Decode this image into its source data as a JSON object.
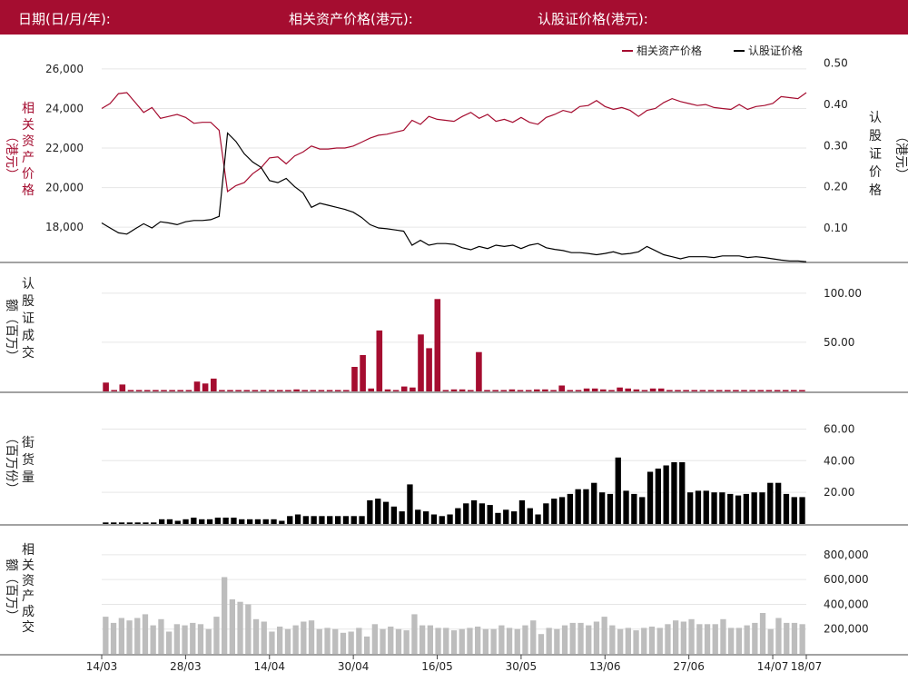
{
  "header": {
    "date_label": "日期(日/月/年):",
    "asset_price_label": "相关资产价格(港元):",
    "warrant_price_label": "认股证价格(港元):"
  },
  "colors": {
    "header": "#a50d30",
    "asset": "#a50d30",
    "warrant": "#000000",
    "turnover_asset": "#bdbdbd"
  },
  "chart_data": [
    {
      "type": "line",
      "panel": "price",
      "legend": [
        "相关资产价格",
        "认股证价格"
      ],
      "legend_position": "top-right",
      "ylabel_left": "相关资产价格（港元）",
      "ylabel_right": "认股证价格（港元）",
      "ylim_left": [
        16400,
        26500
      ],
      "ylim_right": [
        0.025,
        0.51
      ],
      "yticks_left": [
        "18,000",
        "20,000",
        "22,000",
        "24,000",
        "26,000"
      ],
      "yticks_left_values": [
        18000,
        20000,
        22000,
        24000,
        26000
      ],
      "yticks_right": [
        "0.10",
        "0.20",
        "0.30",
        "0.40",
        "0.50"
      ],
      "yticks_right_values": [
        0.1,
        0.2,
        0.3,
        0.4,
        0.5
      ],
      "series": [
        {
          "name": "相关资产价格",
          "axis": "left",
          "values": [
            24000,
            24250,
            24750,
            24800,
            24300,
            23800,
            24050,
            23500,
            23600,
            23700,
            23550,
            23250,
            23300,
            23300,
            22900,
            19800,
            20100,
            20250,
            20700,
            21000,
            21500,
            21550,
            21200,
            21600,
            21800,
            22100,
            21950,
            21950,
            22000,
            22000,
            22100,
            22300,
            22500,
            22650,
            22700,
            22800,
            22900,
            23400,
            23200,
            23600,
            23450,
            23400,
            23350,
            23600,
            23800,
            23500,
            23700,
            23350,
            23450,
            23300,
            23550,
            23300,
            23200,
            23550,
            23700,
            23900,
            23800,
            24100,
            24150,
            24400,
            24100,
            23950,
            24050,
            23900,
            23600,
            23900,
            24000,
            24300,
            24500,
            24350,
            24250,
            24150,
            24200,
            24050,
            24000,
            23950,
            24200,
            23950,
            24100,
            24150,
            24250,
            24600,
            24550,
            24500,
            24800
          ]
        },
        {
          "name": "认股证价格",
          "axis": "right",
          "values": [
            0.112,
            0.1,
            0.088,
            0.085,
            0.098,
            0.11,
            0.1,
            0.115,
            0.112,
            0.108,
            0.115,
            0.118,
            0.118,
            0.12,
            0.128,
            0.33,
            0.31,
            0.28,
            0.26,
            0.247,
            0.215,
            0.21,
            0.22,
            0.2,
            0.185,
            0.15,
            0.16,
            0.155,
            0.15,
            0.145,
            0.138,
            0.125,
            0.108,
            0.1,
            0.098,
            0.095,
            0.092,
            0.058,
            0.07,
            0.058,
            0.062,
            0.062,
            0.06,
            0.052,
            0.047,
            0.055,
            0.05,
            0.058,
            0.055,
            0.058,
            0.05,
            0.058,
            0.062,
            0.052,
            0.048,
            0.045,
            0.04,
            0.04,
            0.038,
            0.035,
            0.038,
            0.042,
            0.036,
            0.038,
            0.042,
            0.055,
            0.045,
            0.035,
            0.03,
            0.025,
            0.03,
            0.03,
            0.03,
            0.028,
            0.032,
            0.032,
            0.032,
            0.028,
            0.03,
            0.028,
            0.025,
            0.022,
            0.02,
            0.02,
            0.018
          ]
        }
      ]
    },
    {
      "type": "bar",
      "panel": "warrant_turnover",
      "ylabel": "认股证成交额（百万）",
      "ylim": [
        0,
        110
      ],
      "yticks": [
        "50.00",
        "100.00"
      ],
      "yticks_values": [
        50,
        100
      ],
      "values": [
        9,
        1,
        7,
        0,
        0,
        0,
        1,
        1,
        0,
        1,
        1,
        10,
        8,
        13,
        1,
        1,
        1,
        1,
        1,
        0,
        1,
        0,
        1,
        2,
        1,
        1,
        1,
        1,
        0,
        1,
        25,
        37,
        3,
        62,
        2,
        1,
        5,
        4,
        58,
        44,
        94,
        1,
        2,
        2,
        1,
        40,
        1,
        1,
        1,
        2,
        1,
        1,
        2,
        2,
        1,
        6,
        1,
        1,
        3,
        3,
        2,
        1,
        4,
        3,
        2,
        1,
        3,
        3,
        1,
        1,
        1,
        1,
        1,
        1,
        1,
        1,
        1,
        1,
        1,
        1,
        1,
        1,
        1,
        1,
        1
      ]
    },
    {
      "type": "bar",
      "panel": "outstanding",
      "ylabel": "街货量（百万份）",
      "ylim": [
        0,
        66
      ],
      "yticks": [
        "20.00",
        "40.00",
        "60.00"
      ],
      "yticks_values": [
        20,
        40,
        60
      ],
      "values": [
        1,
        1,
        1,
        1,
        1,
        1,
        1,
        3,
        3,
        2,
        3,
        4,
        3,
        3,
        4,
        4,
        4,
        3,
        3,
        3,
        3,
        3,
        2,
        5,
        6,
        5,
        5,
        5,
        5,
        5,
        5,
        5,
        5,
        15,
        16,
        14,
        11,
        8,
        25,
        9,
        8,
        6,
        5,
        6,
        10,
        13,
        15,
        13,
        12,
        7,
        9,
        8,
        15,
        10,
        6,
        13,
        16,
        17,
        19,
        22,
        22,
        26,
        20,
        19,
        42,
        21,
        19,
        17,
        33,
        35,
        37,
        39,
        39,
        20,
        21,
        21,
        20,
        20,
        19,
        18,
        19,
        20,
        20,
        26,
        26,
        19,
        17,
        17
      ]
    },
    {
      "type": "bar",
      "panel": "asset_turnover",
      "ylabel": "相关资产成交额（百万）",
      "ylim": [
        0,
        880000
      ],
      "yticks": [
        "200,000",
        "400,000",
        "600,000",
        "800,000"
      ],
      "yticks_values": [
        200000,
        400000,
        600000,
        800000
      ],
      "xticks": [
        "14/03",
        "28/03",
        "14/04",
        "30/04",
        "16/05",
        "30/05",
        "13/06",
        "27/06",
        "14/07",
        "18/07"
      ],
      "xticks_index": [
        0,
        10,
        20,
        30,
        40,
        50,
        60,
        70,
        80,
        84
      ],
      "values": [
        300000,
        250000,
        290000,
        270000,
        290000,
        320000,
        230000,
        280000,
        180000,
        240000,
        230000,
        250000,
        240000,
        200000,
        300000,
        620000,
        440000,
        420000,
        400000,
        280000,
        260000,
        180000,
        220000,
        200000,
        230000,
        260000,
        270000,
        200000,
        210000,
        200000,
        170000,
        180000,
        210000,
        140000,
        240000,
        200000,
        220000,
        200000,
        190000,
        320000,
        230000,
        230000,
        210000,
        210000,
        190000,
        200000,
        210000,
        220000,
        200000,
        200000,
        230000,
        210000,
        200000,
        230000,
        270000,
        160000,
        210000,
        200000,
        230000,
        250000,
        250000,
        230000,
        260000,
        300000,
        230000,
        200000,
        210000,
        190000,
        210000,
        220000,
        210000,
        240000,
        270000,
        260000,
        280000,
        240000,
        240000,
        240000,
        280000,
        210000,
        210000,
        230000,
        250000,
        330000,
        200000,
        290000,
        250000,
        250000,
        240000
      ]
    }
  ]
}
